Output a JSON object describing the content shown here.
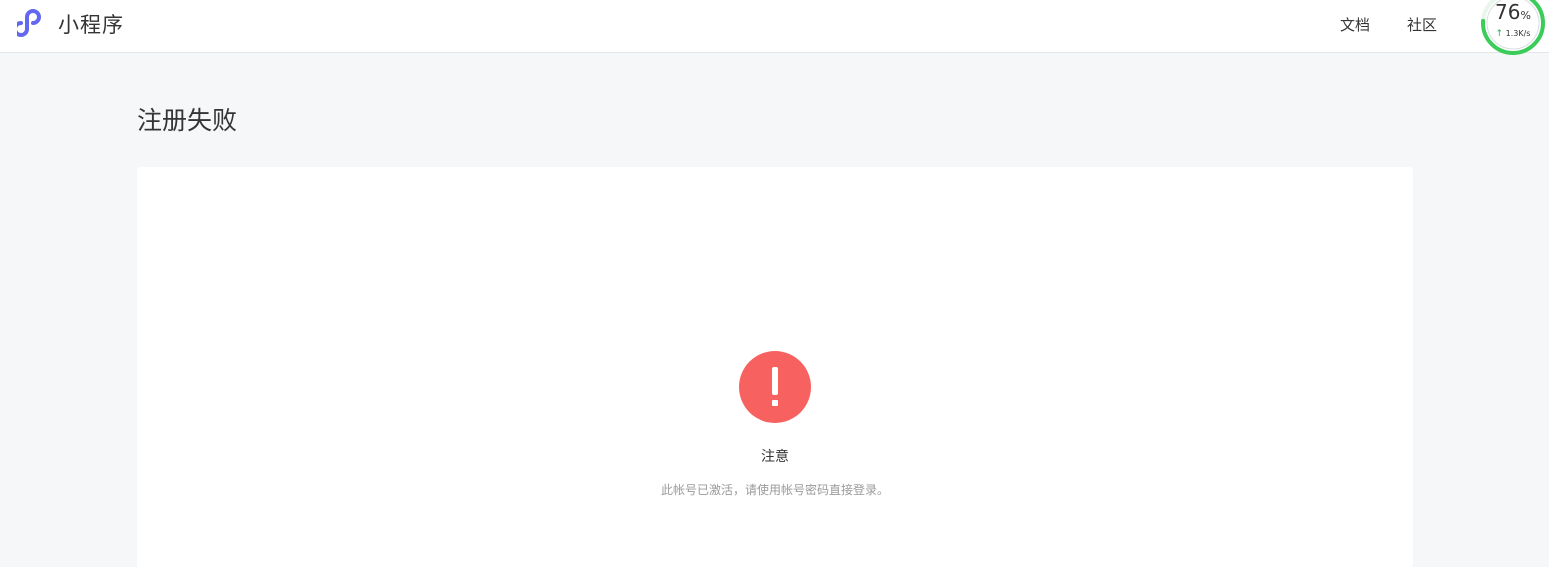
{
  "header": {
    "logo_text": "小程序",
    "nav": [
      {
        "label": "文档"
      },
      {
        "label": "社区"
      }
    ]
  },
  "speed_widget": {
    "percent": "76",
    "percent_unit": "%",
    "upload_arrow": "↑",
    "rate": "1.3K/s",
    "progress_fraction": 0.76,
    "ring_color": "#3ccc5a"
  },
  "page": {
    "title": "注册失败"
  },
  "message": {
    "icon": "exclamation-icon",
    "icon_color": "#f76260",
    "title": "注意",
    "description": "此帐号已激活，请使用帐号密码直接登录。"
  },
  "colors": {
    "brand": "#6467f0",
    "background": "#f6f7f9"
  }
}
